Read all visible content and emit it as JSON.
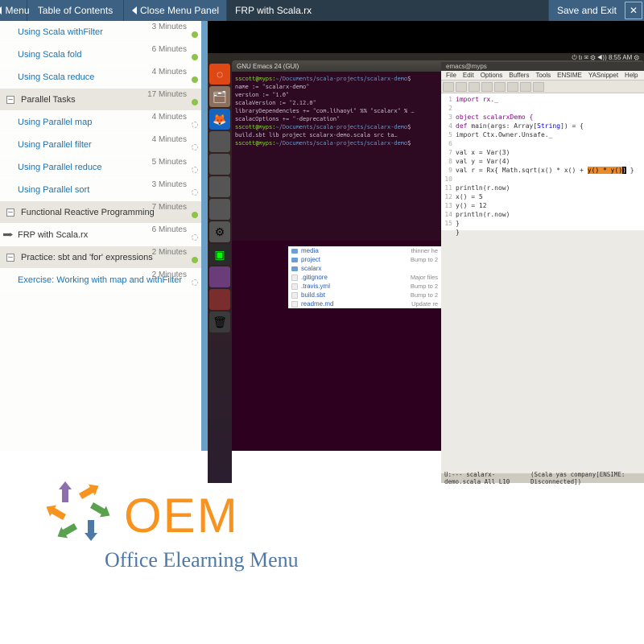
{
  "header": {
    "back_label": "Menu",
    "toc_label": "Table of Contents",
    "close_panel_label": "Close Menu Panel",
    "breadcrumb": "FRP with Scala.rx",
    "save_exit": "Save and Exit",
    "close_x": "✕"
  },
  "toc": [
    {
      "type": "item",
      "label": "Using Scala withFilter",
      "dur": "3 Minutes",
      "status": "done"
    },
    {
      "type": "item",
      "label": "Using Scala fold",
      "dur": "6 Minutes",
      "status": "done"
    },
    {
      "type": "item",
      "label": "Using Scala reduce",
      "dur": "4 Minutes",
      "status": "done"
    },
    {
      "type": "section",
      "label": "Parallel Tasks",
      "dur": "17 Minutes",
      "status": "done"
    },
    {
      "type": "item",
      "label": "Using Parallel map",
      "dur": "4 Minutes",
      "status": "spin"
    },
    {
      "type": "item",
      "label": "Using Parallel filter",
      "dur": "4 Minutes",
      "status": "spin"
    },
    {
      "type": "item",
      "label": "Using Parallel reduce",
      "dur": "5 Minutes",
      "status": "spin"
    },
    {
      "type": "item",
      "label": "Using Parallel sort",
      "dur": "3 Minutes",
      "status": "spin"
    },
    {
      "type": "section",
      "label": "Functional Reactive Programming",
      "dur": "7 Minutes",
      "status": "done"
    },
    {
      "type": "item",
      "label": "FRP with Scala.rx",
      "dur": "6 Minutes",
      "status": "spin",
      "active": true
    },
    {
      "type": "section",
      "label": "Practice: sbt and 'for' expressions",
      "dur": "2 Minutes",
      "status": "done"
    },
    {
      "type": "item",
      "label": "Exercise: Working with map and withFilter",
      "dur": "2 Minutes",
      "status": "spin"
    }
  ],
  "ubuntu": {
    "top_right": "⏻  tı  ✉  ⚙  ◀))  8:55 AM  ⚙",
    "emacs_title": "GNU Emacs 24 (GUI)",
    "emacs_tab": "emacs@myps",
    "menubar": [
      "File",
      "Edit",
      "Options",
      "Buffers",
      "Tools",
      "ENSIME",
      "YASnippet",
      "Help"
    ],
    "terminal_lines": [
      {
        "prompt": "sscott@myps:",
        "path": "~/Documents/scala-projects/scalarx-demo",
        "cmd": "$"
      },
      {
        "text": "name := \"scalarx-demo\""
      },
      {
        "text": "version := \"1.0\""
      },
      {
        "text": "scalaVersion := \"2.12.0\""
      },
      {
        "text": "libraryDependencies += \"com.lihaoyi\" %% \"scalarx\" % …"
      },
      {
        "text": "scalacOptions += \"-deprecation\""
      },
      {
        "prompt": "sscott@myps:",
        "path": "~/Documents/scala-projects/scalarx-demo",
        "cmd": "$"
      },
      {
        "text": "build.sbt  lib  project  scalarx-demo.scala  src  ta…"
      },
      {
        "prompt": "sscott@myps:",
        "path": "~/Documents/scala-projects/scalarx-demo",
        "cmd": "$"
      }
    ],
    "code_gutter": [
      "1",
      "2",
      "3",
      "4",
      "5",
      "6",
      "7",
      "8",
      "9",
      "10",
      "11",
      "12",
      "13",
      "14",
      "15"
    ],
    "status_left": "U:--- scalarx-demo.scala  All  L10",
    "status_right": "(Scala yas company[ENSIME: Disconnected])",
    "files": [
      {
        "name": "media",
        "meta": "thinner he",
        "folder": true
      },
      {
        "name": "project",
        "meta": "Bump to 2",
        "folder": true
      },
      {
        "name": "scalarx",
        "meta": "",
        "folder": true
      },
      {
        "name": ".gitignore",
        "meta": "Major files",
        "folder": false
      },
      {
        "name": ".travis.yml",
        "meta": "Bump to 2",
        "folder": false
      },
      {
        "name": "build.sbt",
        "meta": "Bump to 2",
        "folder": false
      },
      {
        "name": "readme.md",
        "meta": "Update re",
        "folder": false
      }
    ]
  },
  "code": {
    "l1": "import rx._",
    "l3": "object scalarxDemo {",
    "l4a": "  def",
    "l4b": " main(args: Array[",
    "l4c": "String",
    "l4d": "]) = {",
    "l5": "    import Ctx.Owner.Unsafe._",
    "l7": "    val x = Var(3)",
    "l8": "    val y = Var(4)",
    "l9a": "    val r = Rx{ Math.sqrt(x() * x() + ",
    "l9b": "y() * y()",
    "l9c": " }",
    "l11": "    println(r.now)",
    "l12": "    x() = 5",
    "l13": "    y() = 12",
    "l14": "    println(r.now)",
    "l15": "  }",
    "l16": "}"
  },
  "logo": {
    "main": "OEM",
    "sub": "Office Elearning Menu"
  }
}
